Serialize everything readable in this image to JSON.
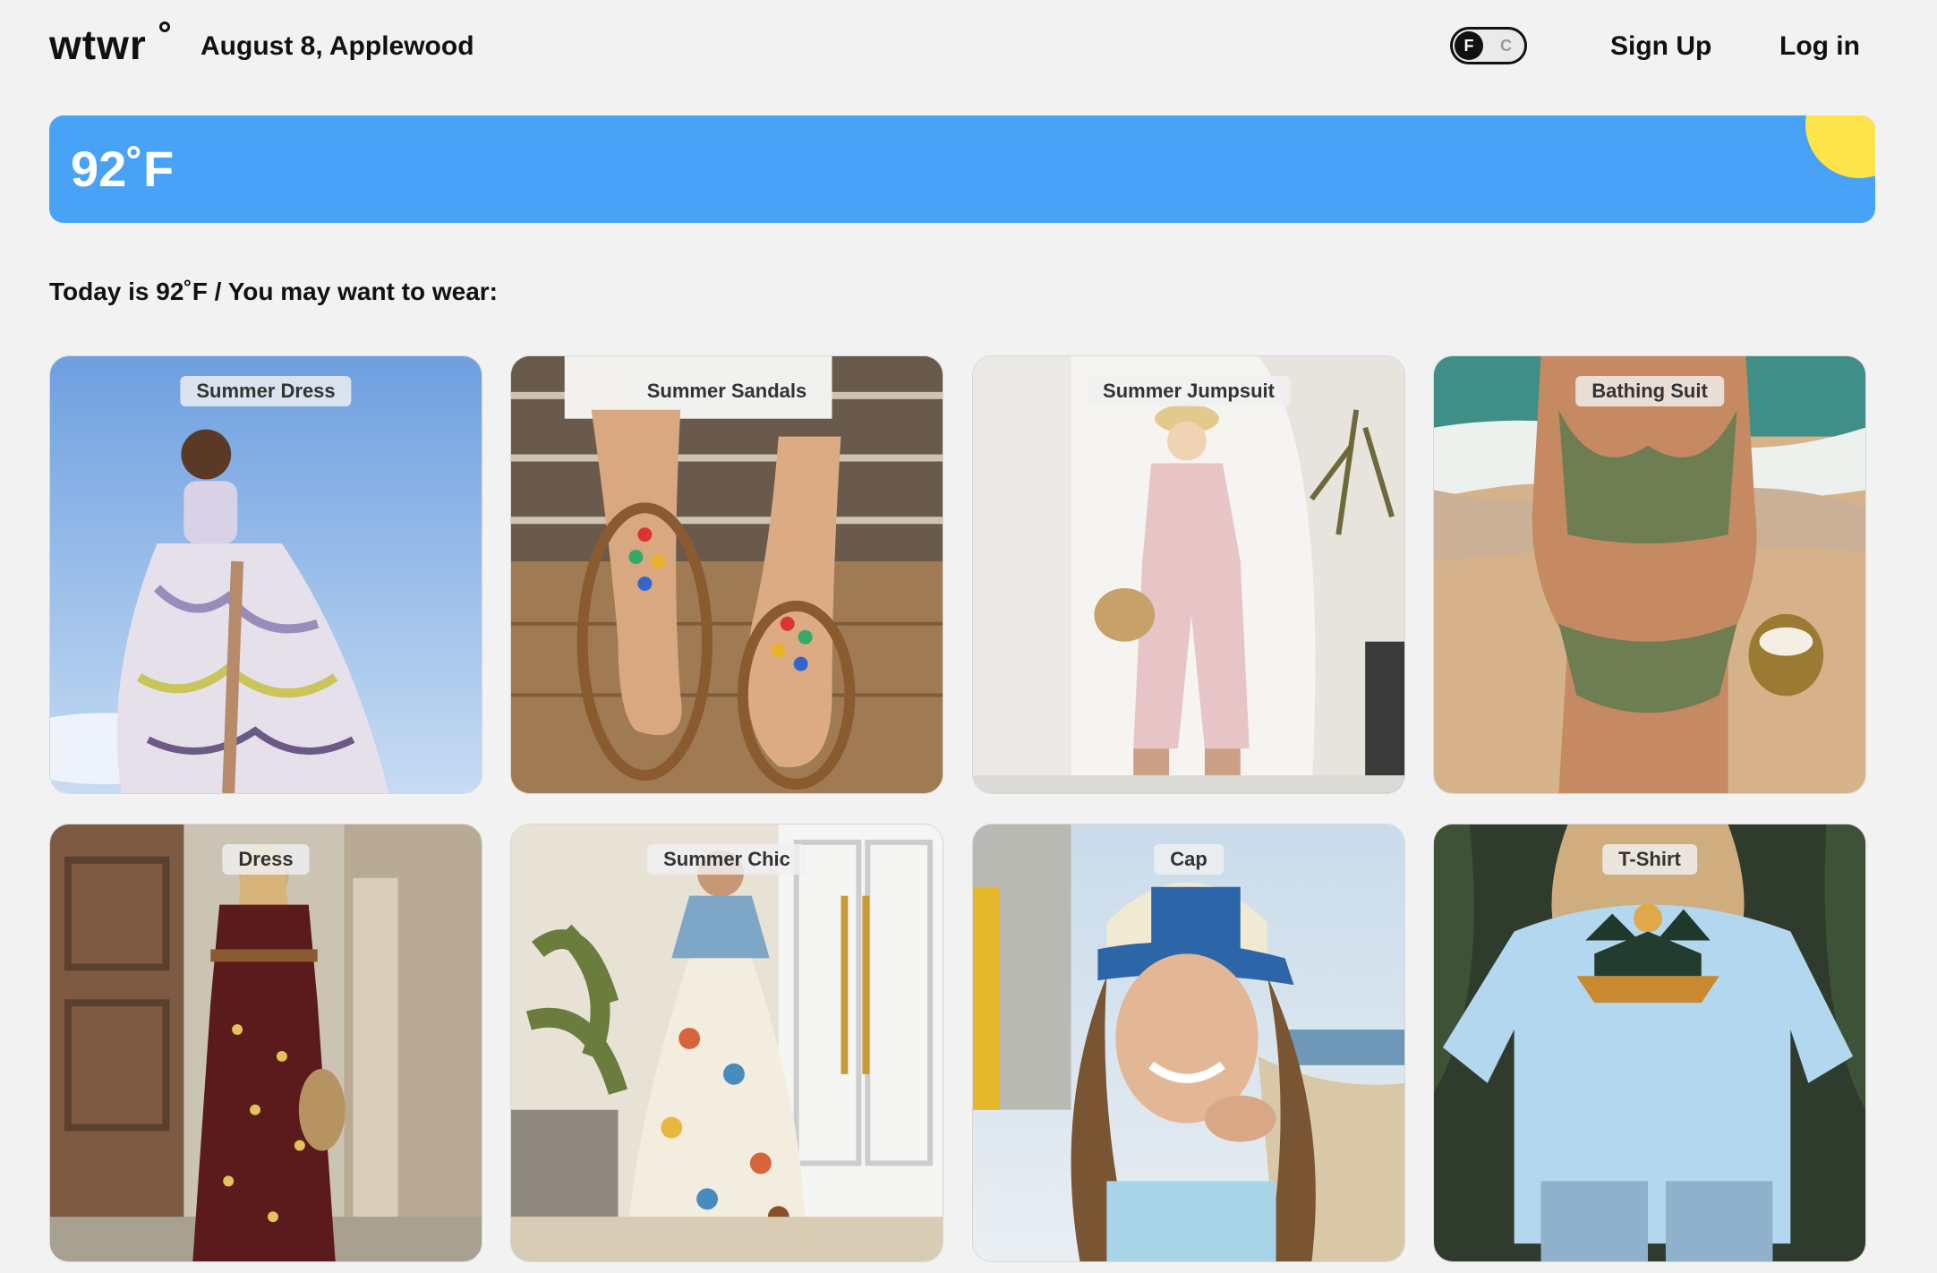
{
  "header": {
    "logo": "wtwr",
    "date_location": "August 8, Applewood",
    "unit_toggle": {
      "active": "F",
      "inactive": "C"
    },
    "sign_up": "Sign Up",
    "log_in": "Log in"
  },
  "weather": {
    "temperature": "92˚F",
    "condition_icon": "sun-icon",
    "banner_color": "#48a2f6",
    "sun_color": "#fce44a"
  },
  "recommendation": "Today is 92˚F / You may want to wear:",
  "items": [
    {
      "label": "Summer Dress"
    },
    {
      "label": "Summer Sandals"
    },
    {
      "label": "Summer Jumpsuit"
    },
    {
      "label": "Bathing Suit"
    },
    {
      "label": "Dress"
    },
    {
      "label": "Summer Chic"
    },
    {
      "label": "Cap"
    },
    {
      "label": "T-Shirt"
    }
  ]
}
